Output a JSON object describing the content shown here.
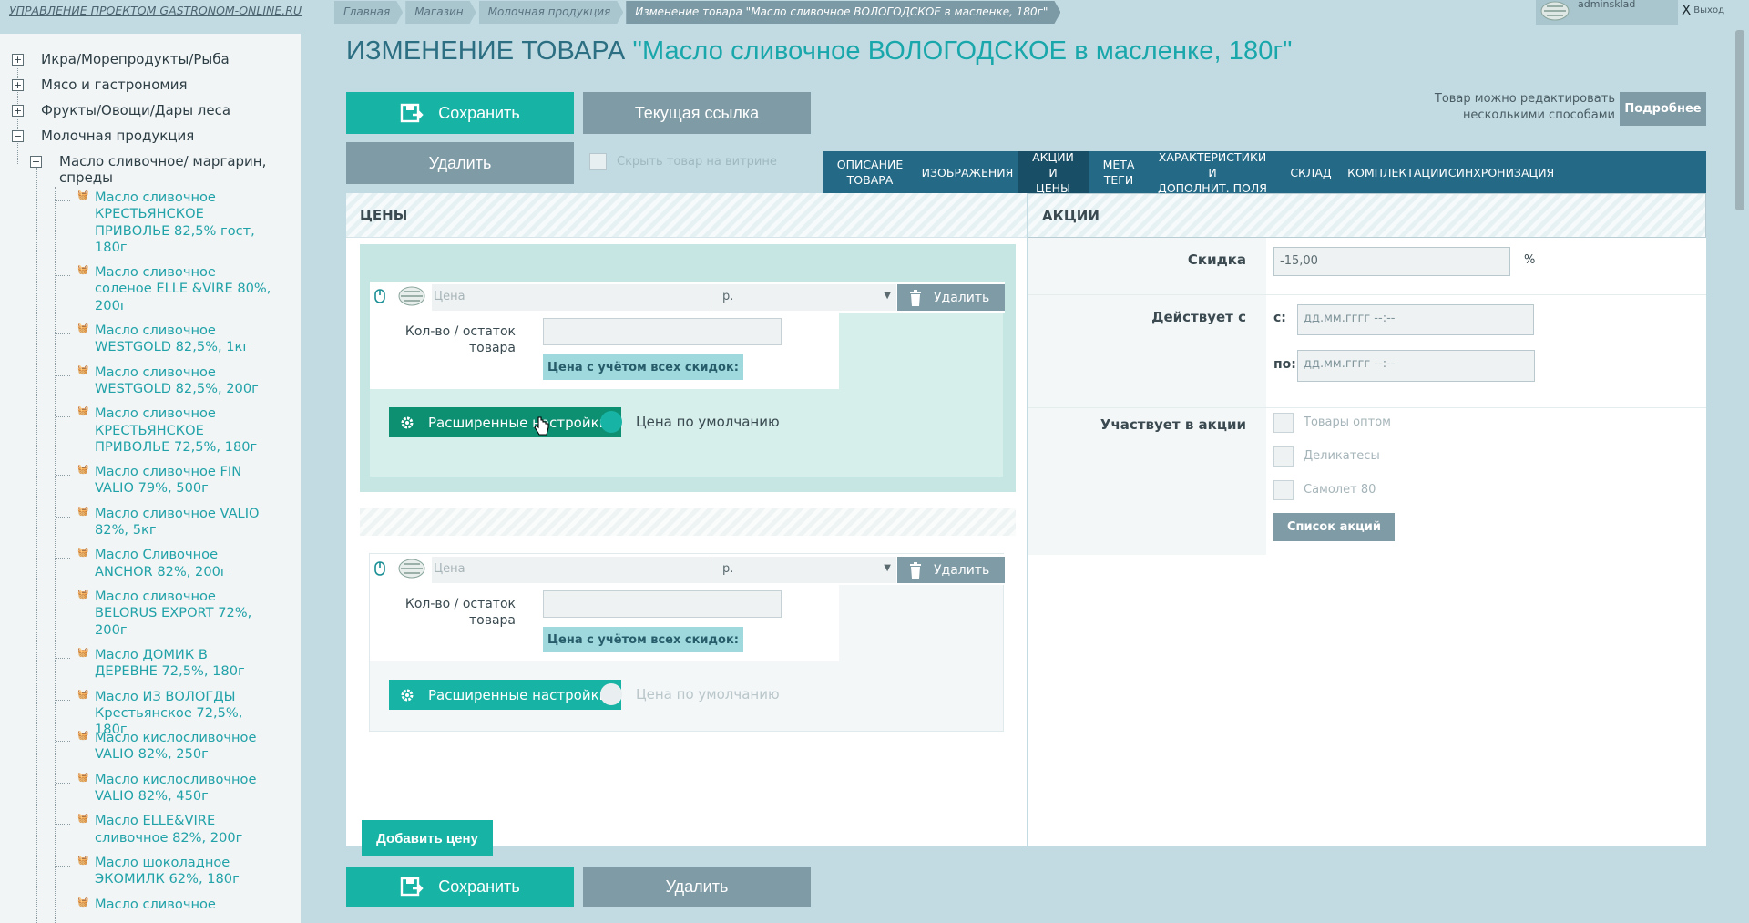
{
  "brand": "УПРАВЛЕНИЕ ПРОЕКТОМ GASTRONOM-ONLINE.RU",
  "breadcrumbs": [
    "Главная",
    "Магазин",
    "Молочная продукция",
    "Изменение товара \"Масло сливочное ВОЛОГОДСКОЕ в масленке, 180г\""
  ],
  "user": {
    "name": "adminsklad",
    "logout": "Выход"
  },
  "sidebar": {
    "categories": [
      "Икра/Морепродукты/Рыба",
      "Мясо и гастрономия",
      "Фрукты/Овощи/Дары леса",
      "Молочная продукция"
    ],
    "subcategory": [
      "Масло сливочное/ маргарин,",
      "спреды"
    ],
    "products": [
      [
        "Масло сливочное",
        "КРЕСТЬЯНСКОЕ",
        "ПРИВОЛЬЕ 82,5% гост,",
        "180г"
      ],
      [
        "Масло сливочное",
        "соленое ELLE &VIRE 80%,",
        "200г"
      ],
      [
        "Масло сливочное",
        "WESTGOLD 82,5%, 1кг"
      ],
      [
        "Масло сливочное",
        "WESTGOLD 82,5%, 200г"
      ],
      [
        "Масло сливочное",
        "КРЕСТЬЯНСКОЕ",
        "ПРИВОЛЬЕ 72,5%, 180г"
      ],
      [
        "Масло сливочное FIN",
        "VALIO 79%, 500г"
      ],
      [
        "Масло сливочное VALIO",
        "82%, 5кг"
      ],
      [
        "Масло Сливочное",
        "ANCHOR 82%, 200г"
      ],
      [
        "Масло сливочное",
        "BELORUS EXPORT 72%,",
        "200г"
      ],
      [
        "Масло ДОМИК В",
        "ДЕРЕВНЕ 72,5%, 180г"
      ],
      [
        "Масло ИЗ ВОЛОГДЫ",
        "Крестьянское 72,5%, 180г"
      ],
      [
        "Масло кислосливочное",
        "VALIO 82%, 250г"
      ],
      [
        "Масло кислосливочное",
        "VALIO 82%, 450г"
      ],
      [
        "Масло ELLE&VIRE",
        "сливочное 82%, 200г"
      ],
      [
        "Масло шоколадное",
        "ЭКОМИЛК 62%, 180г"
      ],
      [
        "Масло сливочное"
      ]
    ]
  },
  "page": {
    "title_prefix": "ИЗМЕНЕНИЕ ТОВАРА",
    "title_product": "\"Масло сливочное ВОЛОГОДСКОЕ в масленке, 180г\""
  },
  "toolbar": {
    "save": "Сохранить",
    "current_link": "Текущая ссылка",
    "delete": "Удалить",
    "hide_label": "Скрыть товар на витрине",
    "edit_note": [
      "Товар можно редактировать",
      "несколькими способами"
    ],
    "more": "Подробнее"
  },
  "tabs": [
    [
      "ОПИСАНИЕ",
      "ТОВАРА"
    ],
    [
      "ИЗОБРАЖЕНИЯ"
    ],
    [
      "АКЦИИ И",
      "ЦЕНЫ"
    ],
    [
      "МЕТА",
      "ТЕГИ"
    ],
    [
      "ХАРАКТЕРИСТИКИ И",
      "ДОПОЛНИТ. ПОЛЯ"
    ],
    [
      "СКЛАД"
    ],
    [
      "КОМПЛЕКТАЦИИ"
    ],
    [
      "СИНХРОНИЗАЦИЯ"
    ]
  ],
  "active_tab": 2,
  "prices": {
    "header": "ЦЕНЫ",
    "blocks": [
      {
        "price_placeholder": "Цена",
        "currency": "р.",
        "delete": "Удалить",
        "qty_label": [
          "Кол-во / остаток",
          "товара"
        ],
        "qty_value": "",
        "discount_btn": "Цена с учётом всех скидок:",
        "advanced": "Расширенные настройки",
        "default_label": "Цена по умолчанию",
        "is_default": true
      },
      {
        "price_placeholder": "Цена",
        "currency": "р.",
        "delete": "Удалить",
        "qty_label": [
          "Кол-во / остаток",
          "товара"
        ],
        "qty_value": "",
        "discount_btn": "Цена с учётом всех скидок:",
        "advanced": "Расширенные настройки",
        "default_label": "Цена по умолчанию",
        "is_default": false
      }
    ],
    "add_price": "Добавить цену"
  },
  "actions": {
    "header": "АКЦИИ",
    "discount_label": "Скидка",
    "discount_value": "-15,00",
    "discount_unit": "%",
    "valid_label": "Действует с",
    "from_label": "с:",
    "to_label": "по:",
    "date_placeholder": "дд.мм.гггг --:--",
    "participates_label": "Участвует в акции",
    "promos": [
      "Товары оптом",
      "Деликатесы",
      "Самолет 80"
    ],
    "promo_list_btn": "Список акций"
  },
  "bottom": {
    "save": "Сохранить",
    "delete": "Удалить"
  },
  "colors": {
    "accent": "#17b3a4",
    "tabs": "#246a86",
    "gray_button": "#7f9ba6",
    "advanced": "#0d8f72",
    "page_bg": "#c2dbe2"
  }
}
